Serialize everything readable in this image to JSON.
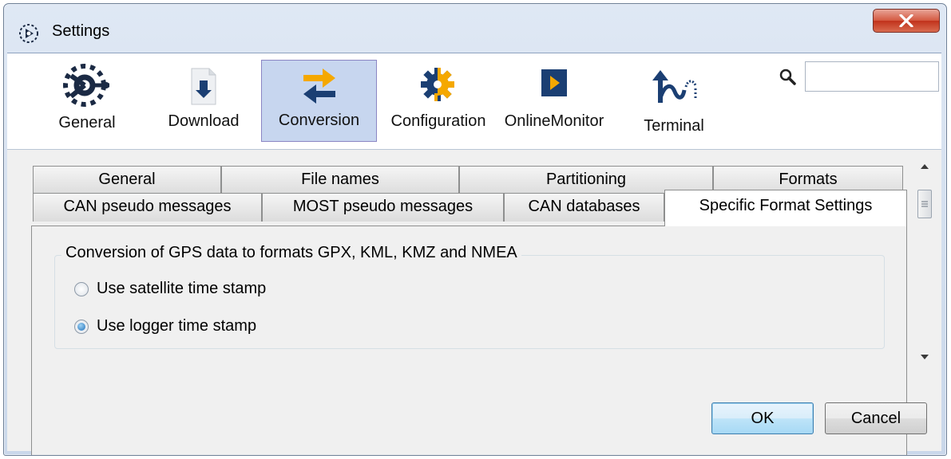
{
  "window": {
    "title": "Settings",
    "close_label": "x"
  },
  "toolbar": {
    "items": [
      {
        "label": "General",
        "icon": "general-settings-icon"
      },
      {
        "label": "Download",
        "icon": "download-icon"
      },
      {
        "label": "Conversion",
        "icon": "conversion-arrows-icon",
        "active": true
      },
      {
        "label": "Configuration",
        "icon": "gear-icon"
      },
      {
        "label": "OnlineMonitor",
        "icon": "play-icon"
      },
      {
        "label": "Terminal",
        "icon": "curved-arrow-icon"
      }
    ],
    "search": {
      "icon": "search-icon",
      "value": ""
    }
  },
  "tabs": {
    "row1": [
      "General",
      "File names",
      "Partitioning",
      "Formats"
    ],
    "row2": [
      "CAN pseudo messages",
      "MOST pseudo messages",
      "CAN databases",
      "Specific Format Settings"
    ],
    "selected": "Specific Format Settings"
  },
  "group": {
    "title": "Conversion of GPS data to formats GPX, KML, KMZ and NMEA",
    "options": [
      {
        "label": "Use satellite time stamp",
        "checked": false
      },
      {
        "label": "Use logger time stamp",
        "checked": true
      }
    ]
  },
  "buttons": {
    "ok": "OK",
    "cancel": "Cancel"
  },
  "colors": {
    "active_tool": "#c7d6ef",
    "accent_orange": "#f5a800",
    "accent_blue": "#1b3f73",
    "close_red": "#c1321c"
  }
}
